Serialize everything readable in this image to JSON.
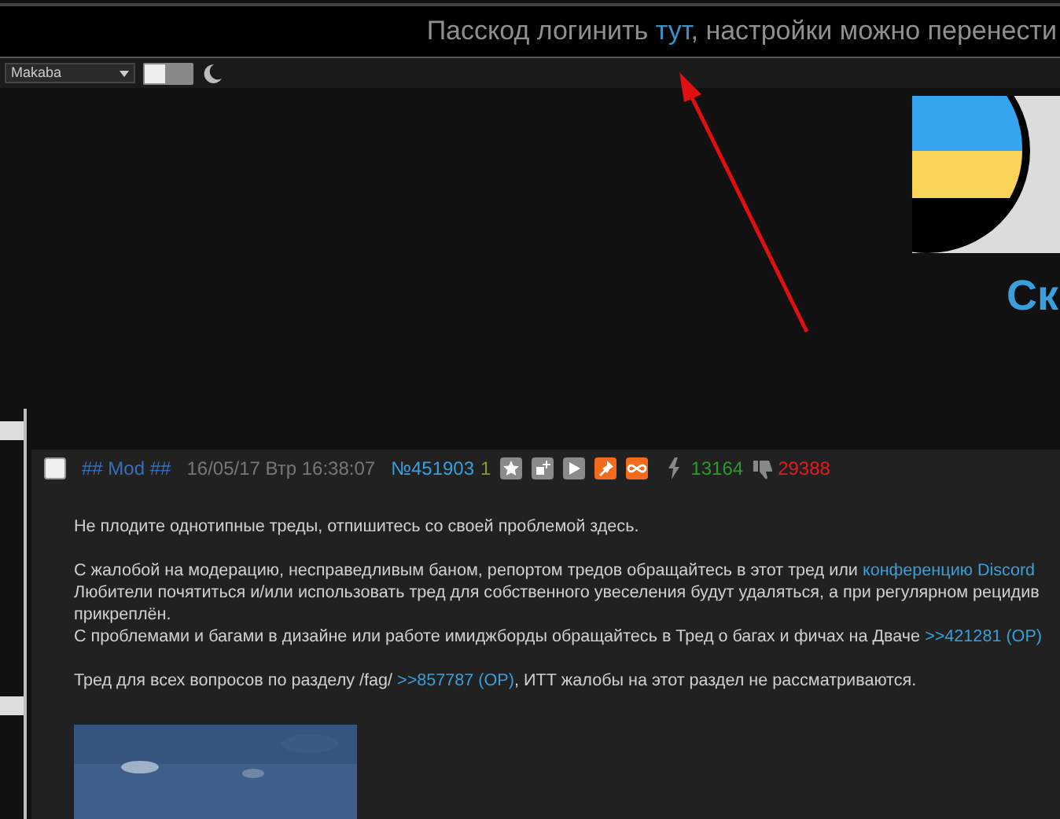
{
  "top_bar": {
    "text_before": "Пасскод логинить ",
    "link": "тут",
    "text_after": ", настройки можно перенести"
  },
  "style_select": {
    "value": "Makaba"
  },
  "theme_toggle": {
    "on": false
  },
  "header": {
    "title": "Ск"
  },
  "post": {
    "checked": false,
    "author": "## Mod ##",
    "date": "16/05/17 Втр 16:38:07",
    "number": "№451903",
    "count": "1",
    "actions": [
      {
        "kind": "star",
        "highlighted": false
      },
      {
        "kind": "add",
        "highlighted": false
      },
      {
        "kind": "play",
        "highlighted": false
      },
      {
        "kind": "pin",
        "highlighted": true
      },
      {
        "kind": "infinity",
        "highlighted": true
      }
    ],
    "likes": "13164",
    "dislikes": "29388",
    "paragraphs": [
      {
        "lines": [
          [
            {
              "text": "Не плодите однотипные треды, отпишитесь со своей проблемой здесь."
            }
          ]
        ]
      },
      {
        "lines": [
          [
            {
              "text": "С жалобой на модерацию, несправедливым баном, репортом тредов обращайтесь в этот тред или "
            },
            {
              "text": "конференцию Discord",
              "kind": "link"
            }
          ],
          [
            {
              "text": "Любители почятиться и/или использовать тред для собственного увеселения будут удаляться, а при регулярном рецидив"
            }
          ],
          [
            {
              "text": "прикреплён."
            }
          ],
          [
            {
              "text": "С проблемами и багами в дизайне или работе имиджборды обращайтесь в Тред о багах и фичах на Дваче "
            },
            {
              "text": ">>421281 (OP)",
              "kind": "link"
            }
          ]
        ]
      },
      {
        "lines": [
          [
            {
              "text": "Тред для всех вопросов по разделу /fag/  "
            },
            {
              "text": ">>857787 (OP)",
              "kind": "link"
            },
            {
              "text": ", ИТТ жалобы на этот раздел не рассматриваются."
            }
          ]
        ]
      }
    ]
  }
}
